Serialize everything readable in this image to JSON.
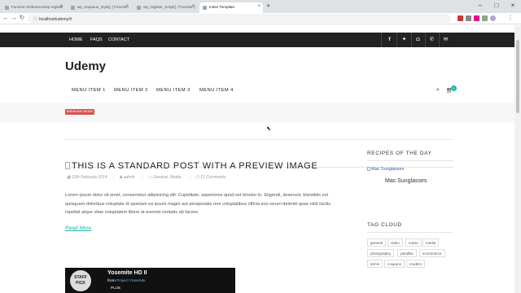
{
  "browser": {
    "tabs": [
      {
        "title": "Function Reference/wp register"
      },
      {
        "title": "wp_enqueue_style() | Function"
      },
      {
        "title": "wp_register_script() | Function |"
      },
      {
        "title": "Index Template"
      }
    ],
    "url": "localhost/udemy/#"
  },
  "topbar": {
    "links": [
      "HOME",
      "FAQS",
      "CONTACT"
    ],
    "social_icons": [
      "facebook-icon",
      "twitter-icon",
      "instagram-icon",
      "phone-icon",
      "mail-icon"
    ]
  },
  "site": {
    "logo": "Udemy"
  },
  "menu": {
    "items": [
      "MENU ITEM 1",
      "MENU ITEM 2",
      "MENU ITEM 3",
      "MENU ITEM 4"
    ],
    "cart_count": "0"
  },
  "breaking": {
    "label": "BREAKING NEWS"
  },
  "post": {
    "title": "THIS IS A STANDARD POST WITH A PREVIEW IMAGE",
    "date": "10th February 2014",
    "author": "admin",
    "categories": "General, Media",
    "comments": "12 Comments",
    "excerpt": "Lorem ipsum dolor sit amet, consectetur adipisicing elit. Cupiditate, asperiores quod est tenetur in. Eligendi, deserunt, blanditiis est quisquam doloribus voluptate id aperiam ea ipsum magni aut perspiciatis rem voluptatibus officia eos rerum deleniti quae nihil facilis repellat atque vitae voluptatem libero at eveniet veritatis ab facere.",
    "read_more": "Read More"
  },
  "video": {
    "badge": "STAFF PICK",
    "title": "Yosemite HD II",
    "from_label": "from",
    "from_name": "Project Yosemite",
    "plus": "PLUS"
  },
  "sidebar": {
    "recipes_title": "RECIPES OF THE DAY",
    "recipe_image_alt": "Mac Sunglasses",
    "recipe_name": "Mac Sunglasses",
    "tags_title": "TAG CLOUD",
    "tags": [
      "general",
      "video",
      "music",
      "media",
      "photography",
      "parallax",
      "ecommerce",
      "terms",
      "coupons",
      "modern"
    ]
  },
  "colors": {
    "accent": "#1cb5a3",
    "breaking": "#d9534f",
    "topbar": "#222222"
  }
}
